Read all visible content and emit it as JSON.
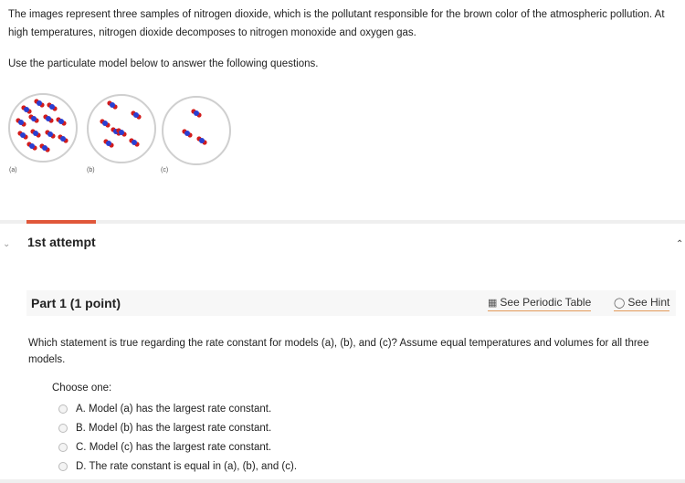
{
  "intro": "The images represent three samples of nitrogen dioxide, which is the pollutant responsible for the brown color of the atmospheric pollution. At high temperatures, nitrogen dioxide decomposes to nitrogen monoxide and oxygen gas.",
  "instruction": "Use the particulate model below to answer the following questions.",
  "figure_labels": [
    "(a)",
    "(b)",
    "(c)"
  ],
  "colors": {
    "nitrogen": "#2a3fd1",
    "oxygen": "#d21c1c",
    "accent": "#e0573a",
    "link_underline": "#e39b5a"
  },
  "attempt": {
    "label": "1st attempt"
  },
  "part": {
    "title": "Part 1   (1 point)",
    "periodic_table_link": "See Periodic Table",
    "hint_link": "See Hint"
  },
  "question": "Which statement is true regarding the rate constant for models (a), (b), and (c)? Assume equal temperatures and volumes for all three models.",
  "choose_label": "Choose one:",
  "options": [
    "A. Model (a) has the largest rate constant.",
    "B. Model (b) has the largest rate constant.",
    "C. Model (c) has the largest rate constant.",
    "D. The rate constant is equal in (a), (b), and (c)."
  ]
}
